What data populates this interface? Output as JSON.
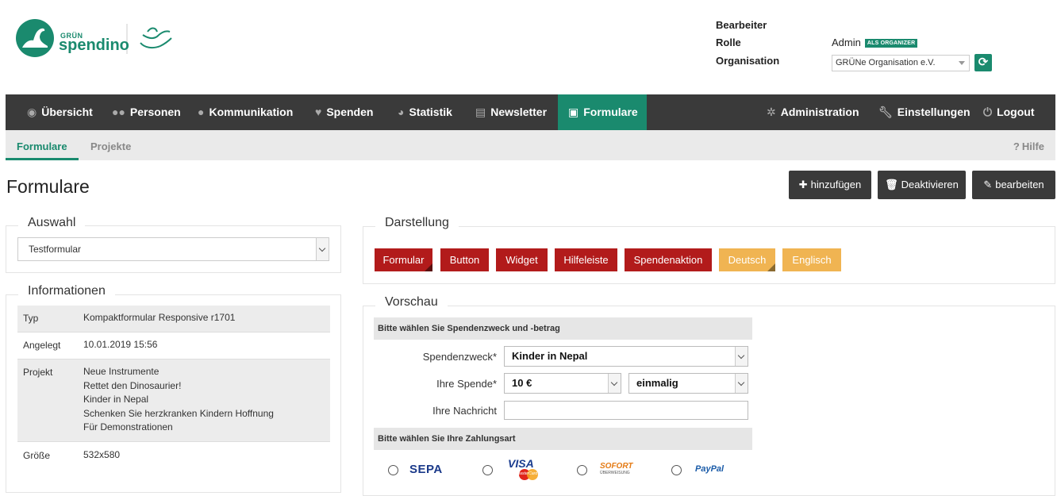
{
  "header": {
    "logo_small": "GRÜN",
    "logo_main": "spendino",
    "meta": [
      {
        "label": "Bearbeiter",
        "value": ""
      },
      {
        "label": "Rolle",
        "value": "Admin",
        "badge": "ALS ORGANIZER"
      },
      {
        "label": "Organisation",
        "value": "GRÜNe Organisation e.V."
      }
    ]
  },
  "nav": {
    "left": [
      {
        "label": "Übersicht",
        "icon": "dashboard-icon"
      },
      {
        "label": "Personen",
        "icon": "users-icon"
      },
      {
        "label": "Kommunikation",
        "icon": "speech-bubble-icon"
      },
      {
        "label": "Spenden",
        "icon": "heart-icon"
      },
      {
        "label": "Statistik",
        "icon": "pie-chart-icon"
      },
      {
        "label": "Newsletter",
        "icon": "newspaper-icon"
      },
      {
        "label": "Formulare",
        "icon": "picture-icon",
        "active": true
      }
    ],
    "right": [
      {
        "label": "Administration",
        "icon": "gears-icon"
      },
      {
        "label": "Einstellungen",
        "icon": "wrench-icon"
      },
      {
        "label": "Logout",
        "icon": "power-icon"
      }
    ]
  },
  "subnav": {
    "tabs": [
      "Formulare",
      "Projekte"
    ],
    "help": "Hilfe"
  },
  "page": {
    "title": "Formulare",
    "actions": [
      "hinzufügen",
      "Deaktivieren",
      "bearbeiten"
    ]
  },
  "auswahl": {
    "legend": "Auswahl",
    "selected": "Testformular"
  },
  "informationen": {
    "legend": "Informationen",
    "rows": [
      {
        "key": "Typ",
        "value": [
          "Kompaktformular Responsive r1701"
        ]
      },
      {
        "key": "Angelegt",
        "value": [
          "10.01.2019 15:56"
        ]
      },
      {
        "key": "Projekt",
        "value": [
          "Neue Instrumente",
          "Rettet den Dinosaurier!",
          "Kinder in Nepal",
          "Schenken Sie herzkranken Kindern Hoffnung",
          "Für Demonstrationen"
        ]
      },
      {
        "key": "Größe",
        "value": [
          "532x580"
        ]
      }
    ]
  },
  "darstellung": {
    "legend": "Darstellung",
    "buttons": [
      "Formular",
      "Button",
      "Widget",
      "Hilfeleiste",
      "Spendenaktion"
    ],
    "languages": [
      "Deutsch",
      "Englisch"
    ],
    "colors": {
      "red": "#b21b1b",
      "orange": "#f0b452",
      "accent": "#1a8a6e"
    }
  },
  "vorschau": {
    "legend": "Vorschau",
    "section1": "Bitte wählen Sie Spendenzweck und -betrag",
    "spendenzweck_label": "Spendenzweck",
    "spendenzweck_value": "Kinder in Nepal",
    "spende_label": "Ihre Spende",
    "spende_amount": "10 €",
    "spende_interval": "einmalig",
    "nachricht_label": "Ihre Nachricht",
    "required_mark": "*",
    "section2": "Bitte wählen Sie Ihre Zahlungsart",
    "payment_methods": [
      "SEPA",
      "VISA",
      "SOFORT",
      "PayPal"
    ],
    "payment_sublabels": {
      "visa": "MasterCard",
      "sofort": "ÜBERWEISUNG"
    }
  }
}
